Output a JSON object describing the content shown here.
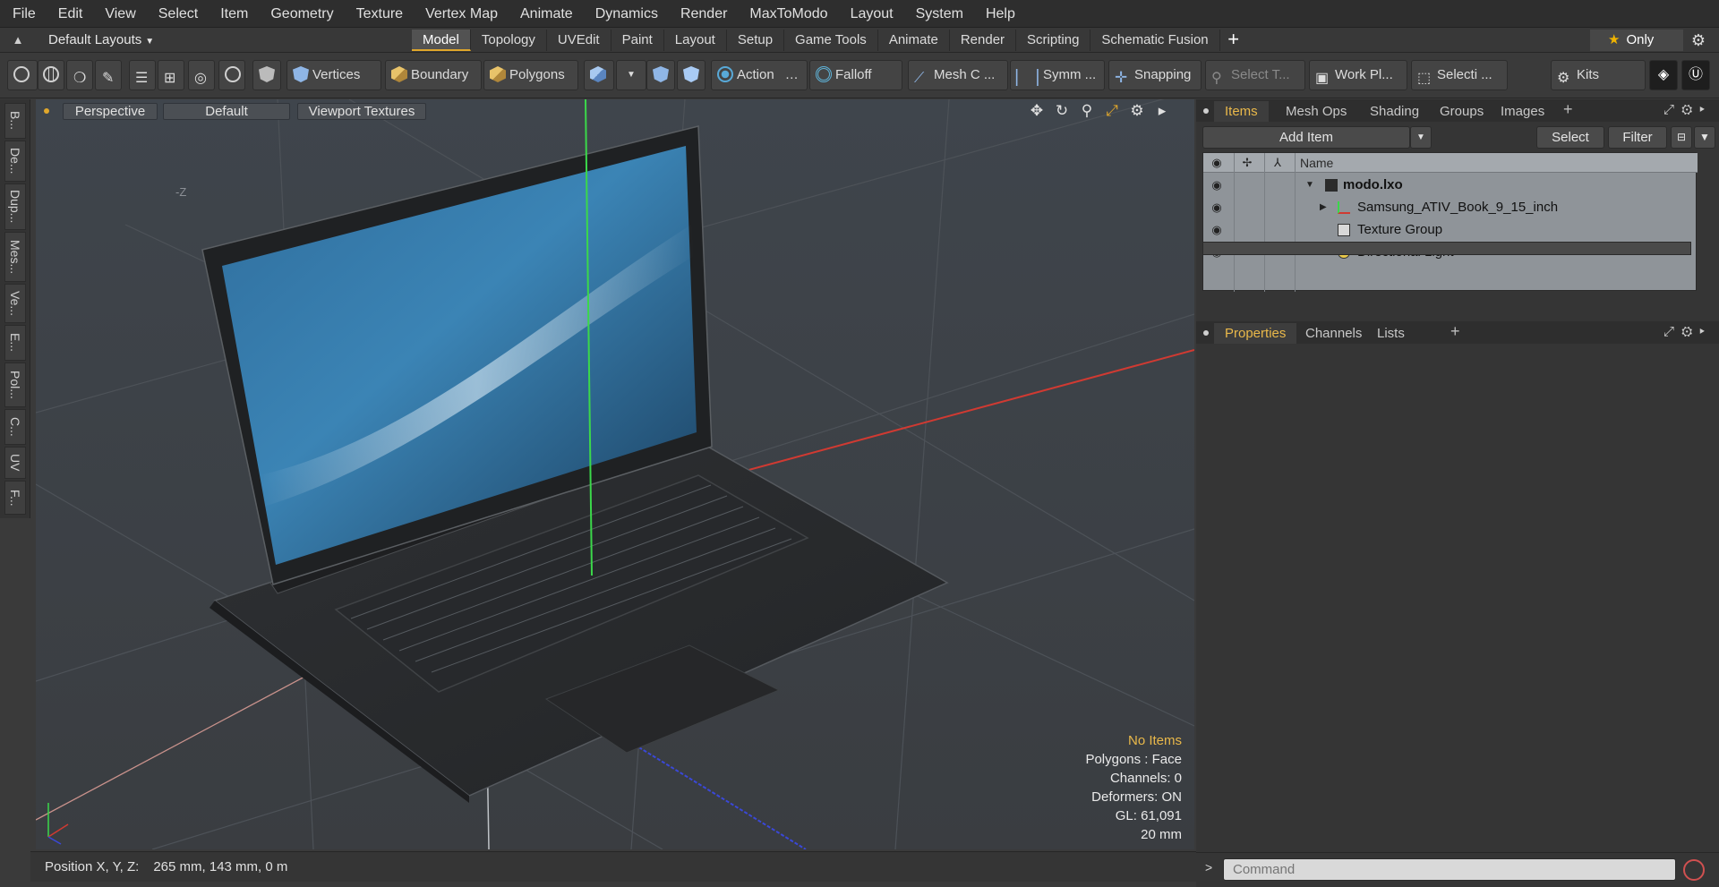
{
  "menubar": [
    "File",
    "Edit",
    "View",
    "Select",
    "Item",
    "Geometry",
    "Texture",
    "Vertex Map",
    "Animate",
    "Dynamics",
    "Render",
    "MaxToModo",
    "Layout",
    "System",
    "Help"
  ],
  "layoutbar": {
    "layouts_label": "Default Layouts",
    "tabs": [
      "Model",
      "Topology",
      "UVEdit",
      "Paint",
      "Layout",
      "Setup",
      "Game Tools",
      "Animate",
      "Render",
      "Scripting",
      "Schematic Fusion"
    ],
    "active_tab": "Model",
    "only_label": "Only"
  },
  "toolbar": {
    "vertices": "Vertices",
    "boundary": "Boundary",
    "polygons": "Polygons",
    "action": "Action",
    "falloff": "Falloff",
    "mesh": "Mesh C ...",
    "symm": "Symm ...",
    "snapping": "Snapping",
    "select_t": "Select T...",
    "workpl": "Work Pl...",
    "selecti": "Selecti ...",
    "kits": "Kits"
  },
  "left_tabs": [
    "B...",
    "De...",
    "Dup...",
    "Mes...",
    "Ve...",
    "E...",
    "Pol...",
    "C...",
    "UV",
    "F..."
  ],
  "viewport": {
    "perspective": "Perspective",
    "default": "Default",
    "textures": "Viewport Textures",
    "axis_z": "-Z",
    "info": {
      "selection": "No Items",
      "polygons": "Polygons : Face",
      "channels": "Channels: 0",
      "deformers": "Deformers: ON",
      "gl": "GL: 61,091",
      "scale": "20 mm"
    }
  },
  "status": {
    "label": "Position X, Y, Z:",
    "value": "265 mm, 143 mm, 0 m"
  },
  "items_panel": {
    "tabs": [
      "Items",
      "Mesh Ops",
      "Shading",
      "Groups",
      "Images"
    ],
    "active_tab": "Items",
    "add_item": "Add Item",
    "select": "Select",
    "filter": "Filter",
    "name_col": "Name",
    "rows": [
      {
        "label": "modo.lxo",
        "bold": true
      },
      {
        "label": "Samsung_ATIV_Book_9_15_inch"
      },
      {
        "label": "Texture Group"
      },
      {
        "label": "Directional Light"
      }
    ]
  },
  "props_panel": {
    "tabs": [
      "Properties",
      "Channels",
      "Lists"
    ],
    "active_tab": "Properties"
  },
  "command": {
    "placeholder": "Command",
    "prompt": ">"
  },
  "colors": {
    "accent": "#e0a72b",
    "axis_x": "#d03a32",
    "axis_y": "#3bd84a",
    "axis_z": "#3a48d8"
  }
}
